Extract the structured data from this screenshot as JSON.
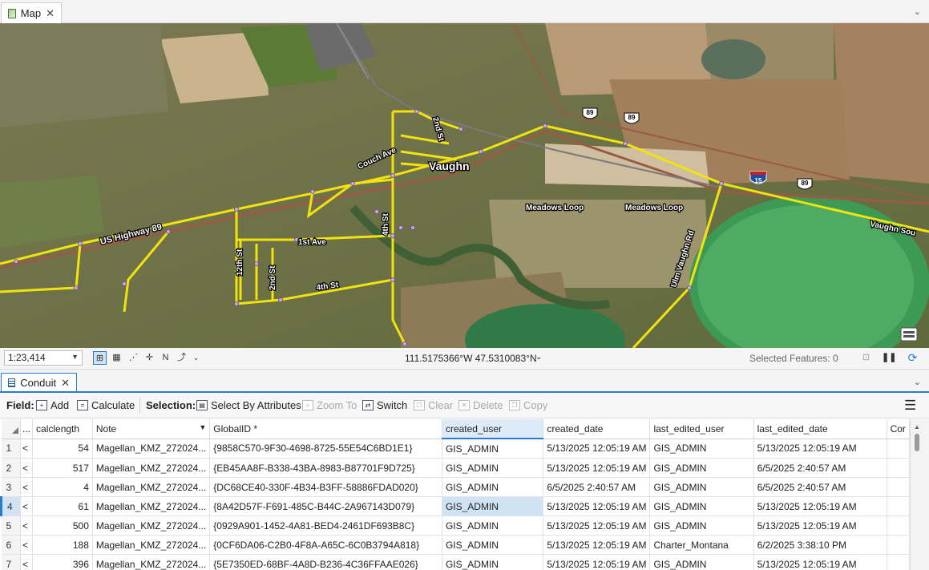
{
  "map_tab": {
    "title": "Map"
  },
  "map": {
    "town_label": "Vaughn",
    "street_labels": {
      "couch_ave": "Couch Ave",
      "second_st_north": "2nd St",
      "us_highway": "US Highway 89",
      "first_ave": "1st Ave",
      "fourth_st_vertical": "4th St",
      "fourth_st": "4th St",
      "twelfth_st": "12th St",
      "second_st_south": "2nd St",
      "meadows_loop_1": "Meadows Loop",
      "meadows_loop_2": "Meadows Loop",
      "ulm_vaughn_rd": "Ulm Vaughn Rd",
      "vaughn_south": "Vaughn Sou"
    },
    "shields": {
      "us89_a": "89",
      "us89_b": "89",
      "us89_c": "89",
      "i15": "15"
    }
  },
  "status_bar": {
    "scale": "1:23,414",
    "coordinates": "111.5175366°W 47.5310083°N",
    "selected_features": "Selected Features: 0"
  },
  "attr_tab": {
    "title": "Conduit"
  },
  "toolbar": {
    "field_label": "Field:",
    "add": "Add",
    "calculate": "Calculate",
    "selection_label": "Selection:",
    "select_by_attributes": "Select By Attributes",
    "zoom_to": "Zoom To",
    "switch": "Switch",
    "clear": "Clear",
    "delete": "Delete",
    "copy": "Copy"
  },
  "table": {
    "columns": [
      "...",
      "calclength",
      "Note",
      "GlobalID *",
      "created_user",
      "created_date",
      "last_edited_user",
      "last_edited_date",
      "Cor"
    ],
    "rows": [
      {
        "n": "1",
        "m": "<",
        "calclength": "54",
        "note": "Magellan_KMZ_272024...",
        "globalid": "{9858C570-9F30-4698-8725-55E54C6BD1E1}",
        "created_user": "GIS_ADMIN",
        "created_date": "5/13/2025 12:05:19 AM",
        "last_edited_user": "GIS_ADMIN",
        "last_edited_date": "5/13/2025 12:05:19 AM"
      },
      {
        "n": "2",
        "m": "<",
        "calclength": "517",
        "note": "Magellan_KMZ_272024...",
        "globalid": "{EB45AA8F-B338-43BA-8983-B87701F9D725}",
        "created_user": "GIS_ADMIN",
        "created_date": "5/13/2025 12:05:19 AM",
        "last_edited_user": "GIS_ADMIN",
        "last_edited_date": "6/5/2025 2:40:57 AM"
      },
      {
        "n": "3",
        "m": "<",
        "calclength": "4",
        "note": "Magellan_KMZ_272024...",
        "globalid": "{DC68CE40-330F-4B34-B3FF-58886FDAD020}",
        "created_user": "GIS_ADMIN",
        "created_date": "6/5/2025 2:40:57 AM",
        "last_edited_user": "GIS_ADMIN",
        "last_edited_date": "6/5/2025 2:40:57 AM"
      },
      {
        "n": "4",
        "m": "<",
        "calclength": "61",
        "note": "Magellan_KMZ_272024...",
        "globalid": "{8A42D57F-F691-485C-B44C-2A967143D079}",
        "created_user": "GIS_ADMIN",
        "created_date": "5/13/2025 12:05:19 AM",
        "last_edited_user": "GIS_ADMIN",
        "last_edited_date": "5/13/2025 12:05:19 AM"
      },
      {
        "n": "5",
        "m": "<",
        "calclength": "500",
        "note": "Magellan_KMZ_272024...",
        "globalid": "{0929A901-1452-4A81-BED4-2461DF693B8C}",
        "created_user": "GIS_ADMIN",
        "created_date": "5/13/2025 12:05:19 AM",
        "last_edited_user": "GIS_ADMIN",
        "last_edited_date": "5/13/2025 12:05:19 AM"
      },
      {
        "n": "6",
        "m": "<",
        "calclength": "188",
        "note": "Magellan_KMZ_272024...",
        "globalid": "{0CF6DA06-C2B0-4F8A-A65C-6C0B3794A818}",
        "created_user": "GIS_ADMIN",
        "created_date": "5/13/2025 12:05:19 AM",
        "last_edited_user": "Charter_Montana",
        "last_edited_date": "6/2/2025 3:38:10 PM"
      },
      {
        "n": "7",
        "m": "<",
        "calclength": "396",
        "note": "Magellan_KMZ_272024...",
        "globalid": "{5E7350ED-68BF-4A8D-B236-4C36FFAAE026}",
        "created_user": "GIS_ADMIN",
        "created_date": "5/13/2025 12:05:19 AM",
        "last_edited_user": "GIS_ADMIN",
        "last_edited_date": "5/13/2025 12:05:19 AM"
      }
    ]
  },
  "colors": {
    "accent": "#2b7bd3",
    "conduit_line": "#f2e30f",
    "vertex": "#c9a2e8"
  }
}
